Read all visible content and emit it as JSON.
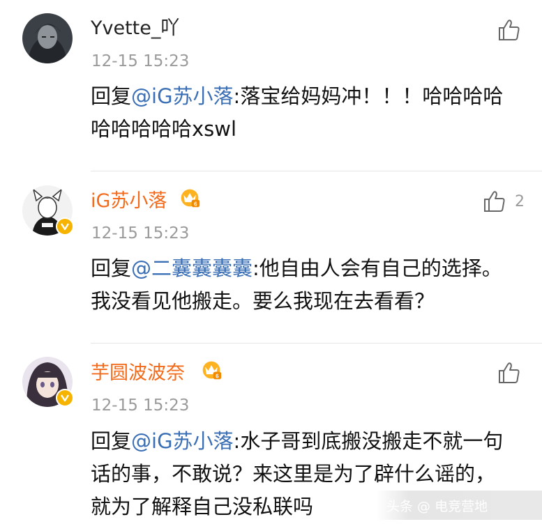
{
  "comments": [
    {
      "username": "Yvette_吖",
      "timestamp": "12-15 15:23",
      "reply_prefix": "回复",
      "mention": "@iG苏小落",
      "text": ":落宝给妈妈冲！！！哈哈哈哈哈哈哈哈哈xswl",
      "like_count": "",
      "vip": false
    },
    {
      "username": "iG苏小落",
      "timestamp": "12-15 15:23",
      "reply_prefix": "回复",
      "mention": "@二囊囊囊囊",
      "text": ":他自由人会有自己的选择。我没看见他搬走。要么我现在去看看？",
      "like_count": "2",
      "vip": true
    },
    {
      "username": "芋圆波波奈",
      "timestamp": "12-15 15:23",
      "reply_prefix": "回复",
      "mention": "@iG苏小落",
      "text": ":水子哥到底搬没搬走不就一句话的事，不敢说？来这里是为了辟什么谣的，就为了解释自己没私联吗",
      "like_count": "",
      "vip": true
    }
  ],
  "watermark": "头条 @ 电竞营地",
  "colors": {
    "vip_name": "#f26a1a",
    "mention": "#3a6fb6",
    "timestamp": "#9a9a9a",
    "badge": "#f6b400"
  }
}
